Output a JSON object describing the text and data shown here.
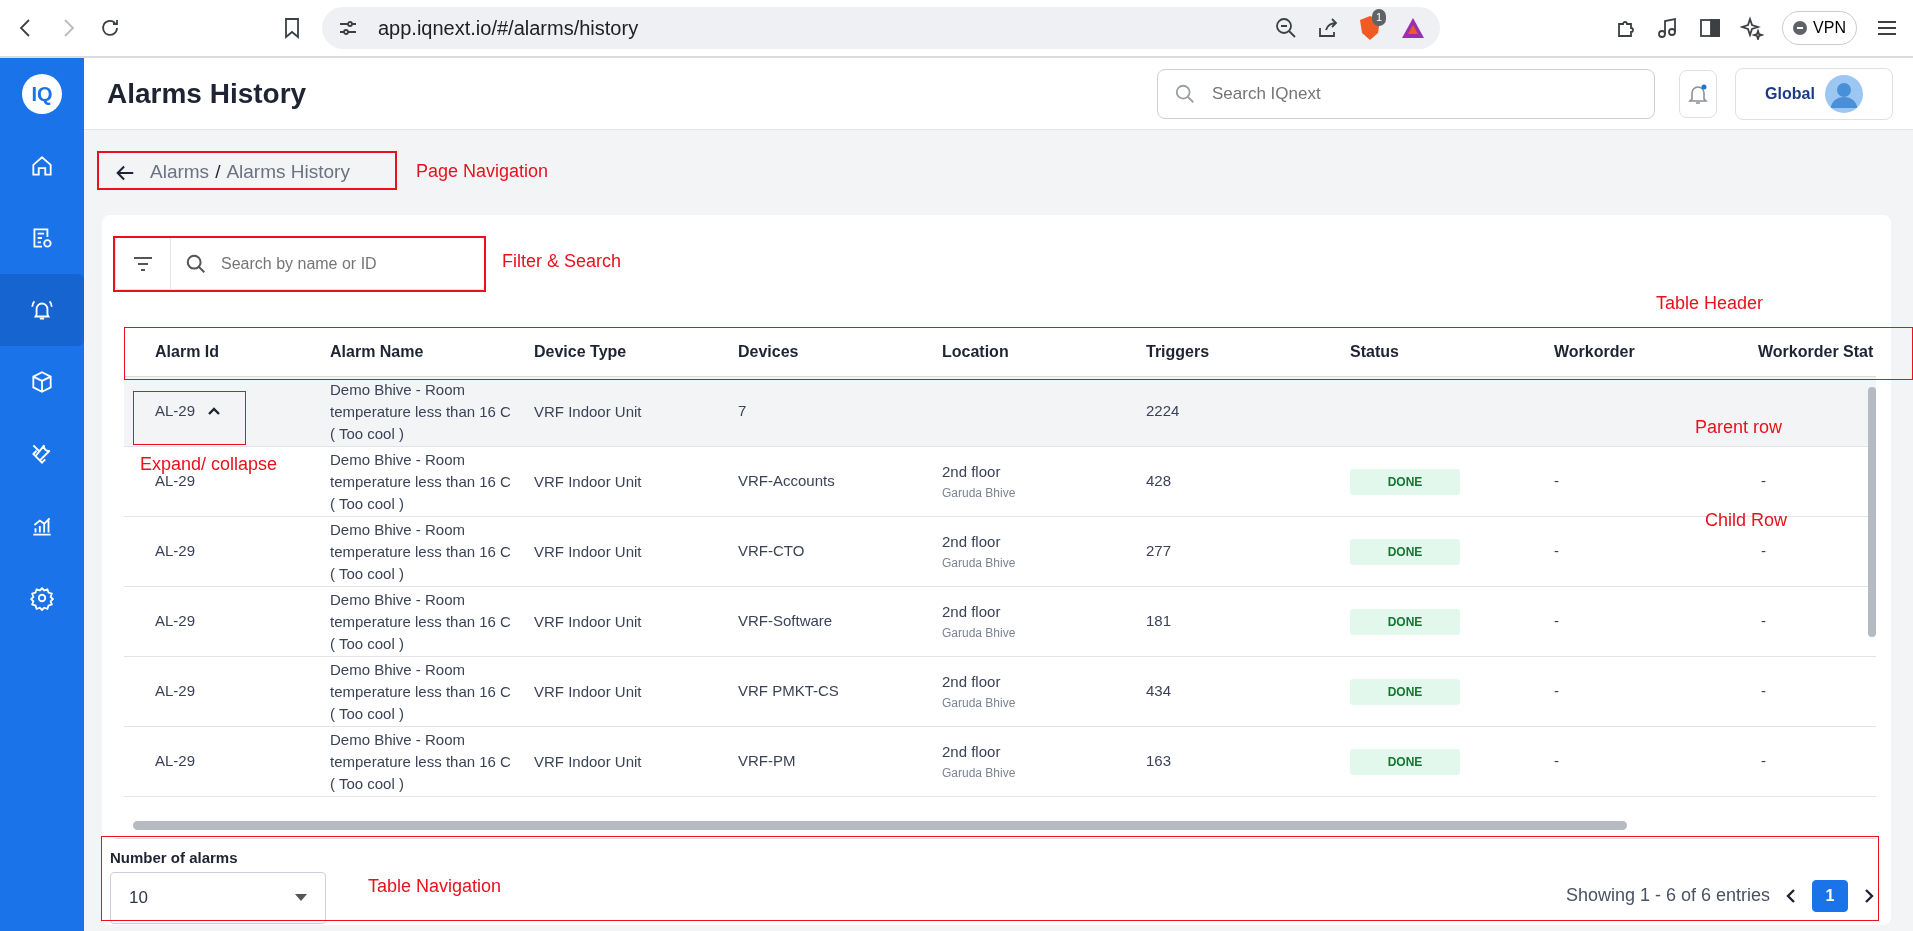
{
  "browser": {
    "url": "app.iqnext.io/#/alarms/history",
    "shield_count": "1",
    "vpn": "VPN",
    "forward_disabled": true
  },
  "app": {
    "logo": "IQ",
    "title": "Alarms History",
    "search_placeholder": "Search IQnext",
    "profile_logo": "Global"
  },
  "sidebar": {
    "items": [
      {
        "selected": false
      },
      {
        "selected": false
      },
      {
        "selected": true
      },
      {
        "selected": false
      },
      {
        "selected": false
      },
      {
        "selected": false
      },
      {
        "selected": false
      }
    ]
  },
  "breadcrumb": {
    "items": [
      "Alarms",
      "Alarms History"
    ],
    "separator": "/"
  },
  "search": {
    "placeholder": "Search by name or ID"
  },
  "table": {
    "columns": [
      "Alarm Id",
      "Alarm Name",
      "Device Type",
      "Devices",
      "Location",
      "Triggers",
      "Status",
      "Workorder",
      "Workorder Stat"
    ],
    "rows": [
      {
        "kind": "parent",
        "expanded": true,
        "alarm_id": "AL-29",
        "alarm_name": "Demo Bhive - Room temperature less than 16 C ( Too cool )",
        "device_type": "VRF Indoor Unit",
        "devices": "7",
        "triggers": "2224"
      },
      {
        "kind": "child",
        "alarm_id": "AL-29",
        "alarm_name": "Demo Bhive - Room temperature less than 16 C ( Too cool )",
        "device_type": "VRF Indoor Unit",
        "devices": "VRF-Accounts",
        "location": "2nd floor",
        "building": "Garuda Bhive",
        "triggers": "428",
        "status": "DONE",
        "workorder": "-",
        "workorder_status": "-"
      },
      {
        "kind": "child",
        "alarm_id": "AL-29",
        "alarm_name": "Demo Bhive - Room temperature less than 16 C ( Too cool )",
        "device_type": "VRF Indoor Unit",
        "devices": "VRF-CTO",
        "location": "2nd floor",
        "building": "Garuda Bhive",
        "triggers": "277",
        "status": "DONE",
        "workorder": "-",
        "workorder_status": "-"
      },
      {
        "kind": "child",
        "alarm_id": "AL-29",
        "alarm_name": "Demo Bhive - Room temperature less than 16 C ( Too cool )",
        "device_type": "VRF Indoor Unit",
        "devices": "VRF-Software",
        "location": "2nd floor",
        "building": "Garuda Bhive",
        "triggers": "181",
        "status": "DONE",
        "workorder": "-",
        "workorder_status": "-"
      },
      {
        "kind": "child",
        "alarm_id": "AL-29",
        "alarm_name": "Demo Bhive - Room temperature less than 16 C ( Too cool )",
        "device_type": "VRF Indoor Unit",
        "devices": "VRF PMKT-CS",
        "location": "2nd floor",
        "building": "Garuda Bhive",
        "triggers": "434",
        "status": "DONE",
        "workorder": "-",
        "workorder_status": "-"
      },
      {
        "kind": "child",
        "alarm_id": "AL-29",
        "alarm_name": "Demo Bhive - Room temperature less than 16 C ( Too cool )",
        "device_type": "VRF Indoor Unit",
        "devices": "VRF-PM",
        "location": "2nd floor",
        "building": "Garuda Bhive",
        "triggers": "163",
        "status": "DONE",
        "workorder": "-",
        "workorder_status": "-"
      }
    ]
  },
  "footer": {
    "page_size_label": "Number of alarms",
    "page_size": "10",
    "summary": "Showing 1 - 6 of 6 entries",
    "pages": [
      {
        "label": "1",
        "selected": true
      }
    ]
  },
  "annotations": [
    {
      "label": "Page Navigation"
    },
    {
      "label": "Filter & Search"
    },
    {
      "label": "Table Header"
    },
    {
      "label": "Expand/ collapse"
    },
    {
      "label": "Parent row"
    },
    {
      "label": "Child Row"
    },
    {
      "label": "Table Navigation"
    }
  ]
}
